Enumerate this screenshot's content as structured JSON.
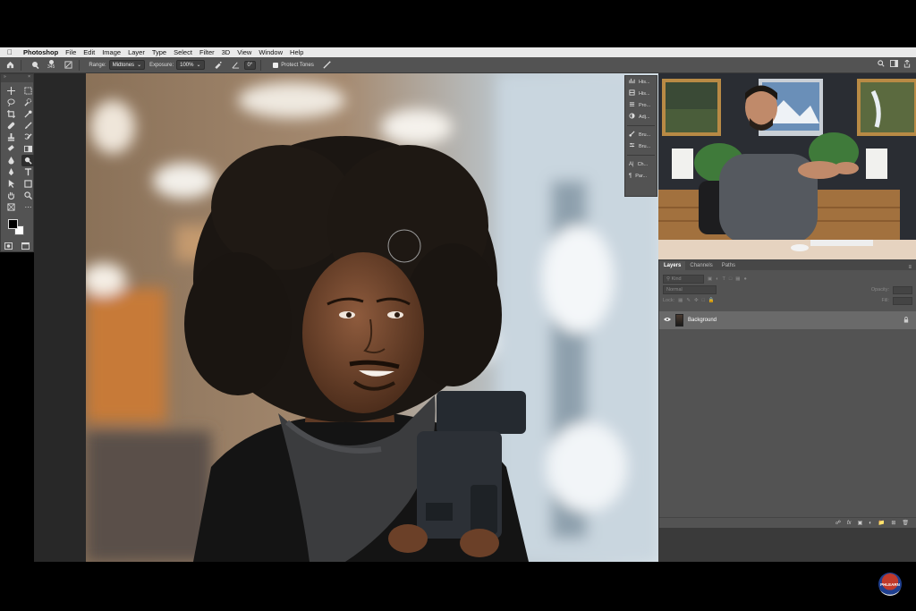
{
  "menubar": {
    "app_name": "Photoshop",
    "items": [
      "File",
      "Edit",
      "Image",
      "Layer",
      "Type",
      "Select",
      "Filter",
      "3D",
      "View",
      "Window",
      "Help"
    ]
  },
  "options": {
    "brush_size": "345",
    "range_label": "Range:",
    "range_value": "Midtones",
    "exposure_label": "Exposure:",
    "exposure_value": "100%",
    "angle_value": "0°",
    "protect_tones_label": "Protect Tones"
  },
  "adjustments": {
    "items": [
      "His...",
      "His...",
      "Pro...",
      "Adj...",
      "Bru...",
      "Bru...",
      "Ch...",
      "Par..."
    ]
  },
  "layers_panel": {
    "tabs": [
      "Layers",
      "Channels",
      "Paths"
    ],
    "kind_label": "Kind",
    "blend_mode": "Normal",
    "opacity_label": "Opacity:",
    "lock_label": "Lock:",
    "fill_label": "Fill:",
    "layer_name": "Background"
  },
  "logo_text": "PHLEARN",
  "colors": {
    "ps_panel": "#535353",
    "menubar": "#e9e9e9",
    "active_layer": "#6a6a6a"
  }
}
